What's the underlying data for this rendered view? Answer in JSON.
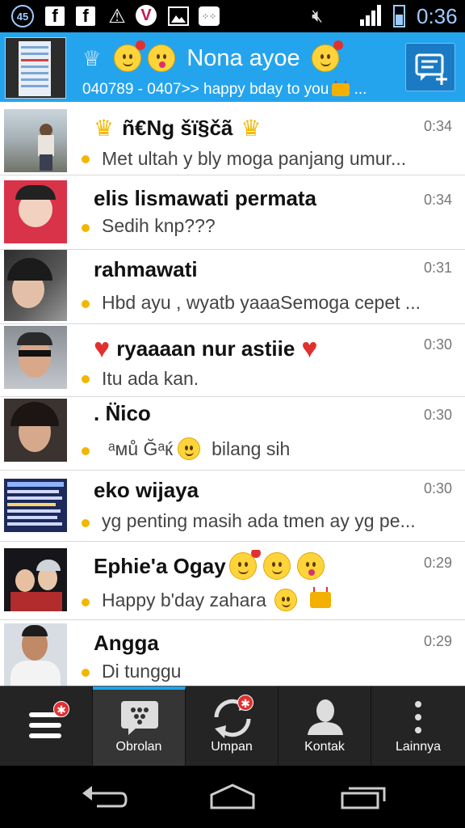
{
  "status_bar": {
    "notification_count": "45",
    "clock": "0:36",
    "icons": [
      "notification-badge-icon",
      "facebook-icon",
      "facebook-icon",
      "warning-icon",
      "v-app-icon",
      "image-icon",
      "bbm-icon",
      "mute-icon",
      "signal-icon",
      "battery-icon"
    ]
  },
  "header": {
    "name": "Nona ayoe",
    "status": "040789 - 0407>> happy bday to you",
    "status_ellipsis": "...",
    "accent_color": "#25a4ee"
  },
  "chats": [
    {
      "name": "ñ€Ng šï§čã",
      "time": "0:34",
      "message": "Met ultah y bly moga panjang umur..."
    },
    {
      "name": "elis lismawati permata",
      "time": "0:34",
      "message": "Sedih knp???"
    },
    {
      "name": "rahmawati",
      "time": "0:31",
      "message": "Hbd ayu , wyatb yaaaSemoga cepet ..."
    },
    {
      "name": "ryaaaan nur astiie",
      "time": "0:30",
      "message": "Itu ada kan."
    },
    {
      "name": ". N̈̈̈ico",
      "time": "0:30",
      "message": "ᵃмů Ğᵃќ",
      "message_tail": "bilang sih"
    },
    {
      "name": "eko wijaya",
      "time": "0:30",
      "message": "yg penting masih ada tmen ay yg pe..."
    },
    {
      "name": "Ephie'a Ogay",
      "time": "0:29",
      "message": "Happy b'day zahara"
    },
    {
      "name": "Angga",
      "time": "0:29",
      "message": "Di tunggu"
    }
  ],
  "toolbar": {
    "tabs": [
      {
        "label": "",
        "icon": "menu-icon"
      },
      {
        "label": "Obrolan",
        "icon": "chat-icon"
      },
      {
        "label": "Umpan",
        "icon": "refresh-icon"
      },
      {
        "label": "Kontak",
        "icon": "contact-icon"
      },
      {
        "label": "Lainnya",
        "icon": "more-icon"
      }
    ],
    "badge": "✱"
  }
}
